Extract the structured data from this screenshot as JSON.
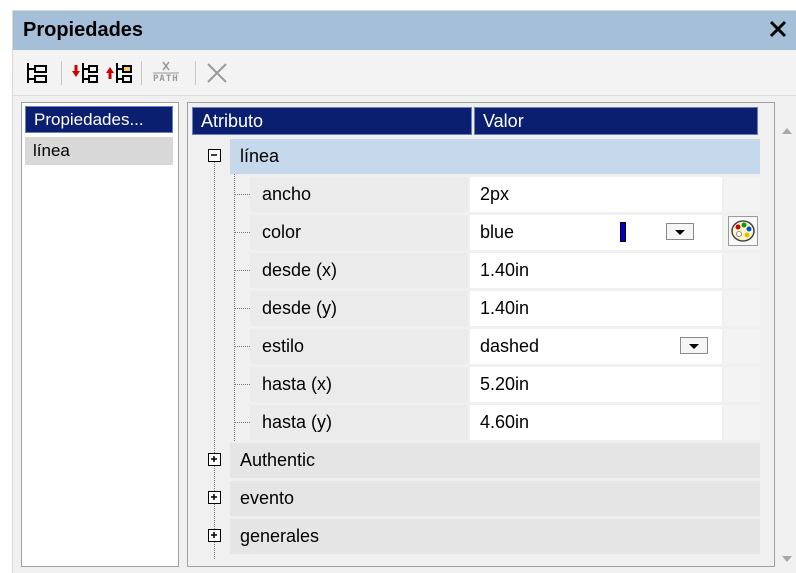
{
  "panel": {
    "title": "Propiedades"
  },
  "toolbar": {
    "icons": [
      "tree-view-icon",
      "insert-before-icon",
      "insert-after-icon",
      "xpath-icon",
      "delete-icon"
    ],
    "xpath_label": "PATH"
  },
  "left": {
    "header": "Propiedades...",
    "item": "línea"
  },
  "grid": {
    "col_attribute": "Atributo",
    "col_value": "Valor",
    "group_open": "línea",
    "rows": [
      {
        "name": "ancho",
        "value": "2px"
      },
      {
        "name": "color",
        "value": "blue"
      },
      {
        "name": "desde (x)",
        "value": "1.40in"
      },
      {
        "name": "desde (y)",
        "value": "1.40in"
      },
      {
        "name": "estilo",
        "value": "dashed"
      },
      {
        "name": "hasta (x)",
        "value": "5.20in"
      },
      {
        "name": "hasta (y)",
        "value": "4.60in"
      }
    ],
    "groups_closed": [
      "Authentic",
      "evento",
      "generales"
    ]
  },
  "colors": {
    "title_bg": "#a6bfd9",
    "header_bg": "#0a1f6f",
    "selected_row": "#c5d8ec",
    "swatch": "#0000c8"
  }
}
